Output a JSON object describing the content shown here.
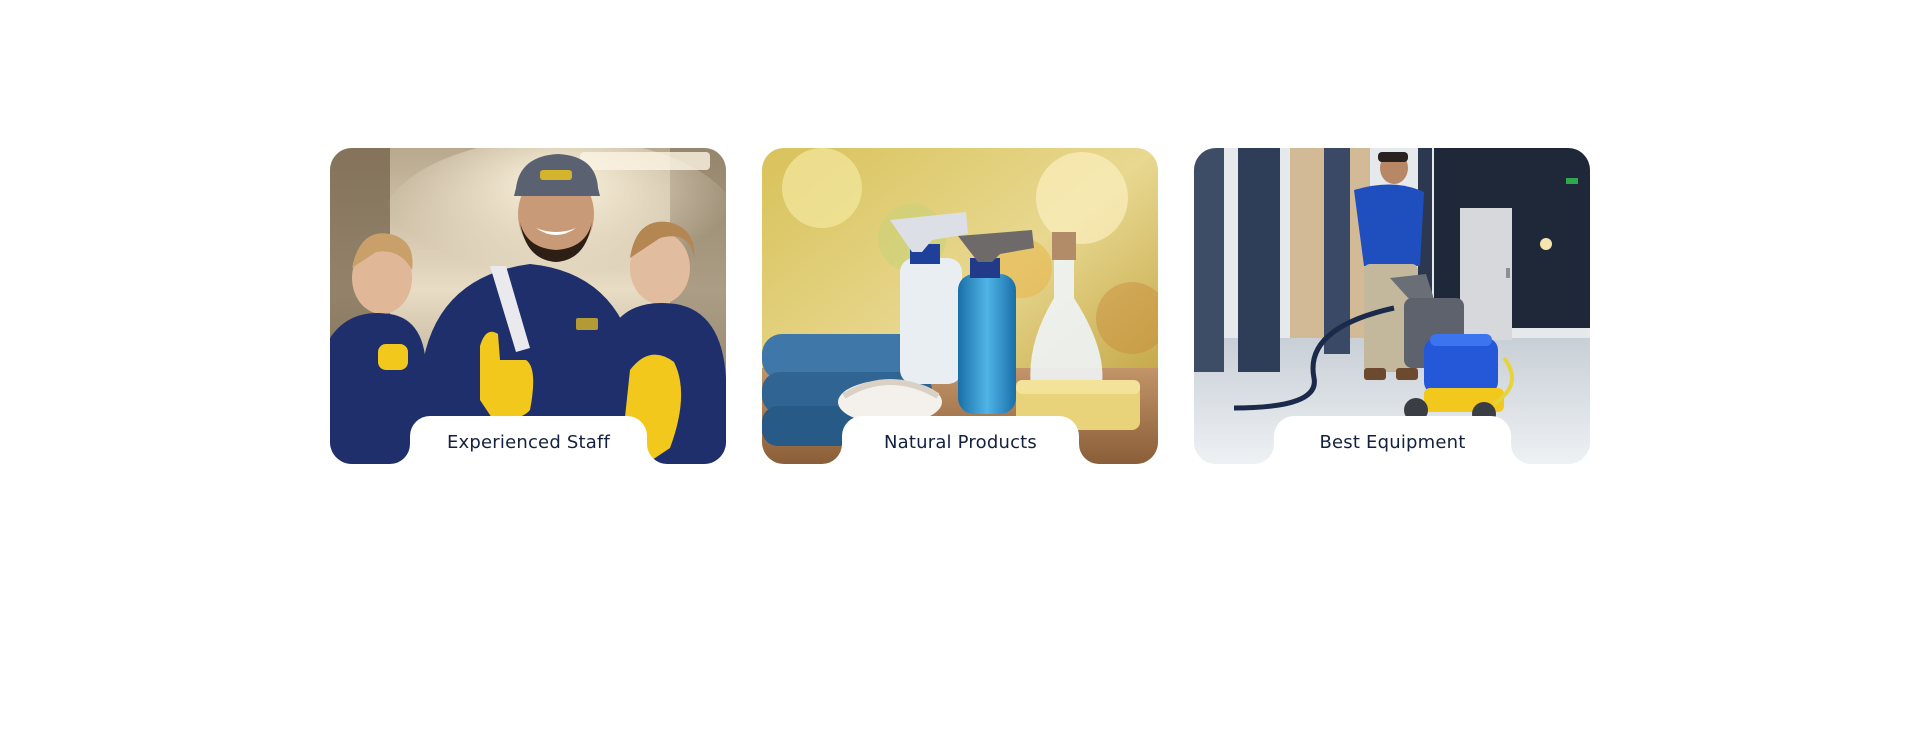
{
  "features": [
    {
      "caption": "Experienced Staff",
      "image": "photo-cleaning-staff-thumbs-up",
      "alt": "Smiling cleaning staff in navy uniforms and yellow gloves giving a thumbs up"
    },
    {
      "caption": "Natural Products",
      "image": "photo-cleaning-products",
      "alt": "Spray bottles, blue towels, a brush and a sponge on a wooden table"
    },
    {
      "caption": "Best Equipment",
      "image": "photo-floor-cleaning-machine",
      "alt": "Worker operating a blue floor scrubbing machine in a lobby"
    }
  ],
  "colors": {
    "caption_text": "#14203f",
    "uniform_navy": "#1e2f6b",
    "glove_yellow": "#f2c81d",
    "spray_blue": "#2a8fc8"
  }
}
